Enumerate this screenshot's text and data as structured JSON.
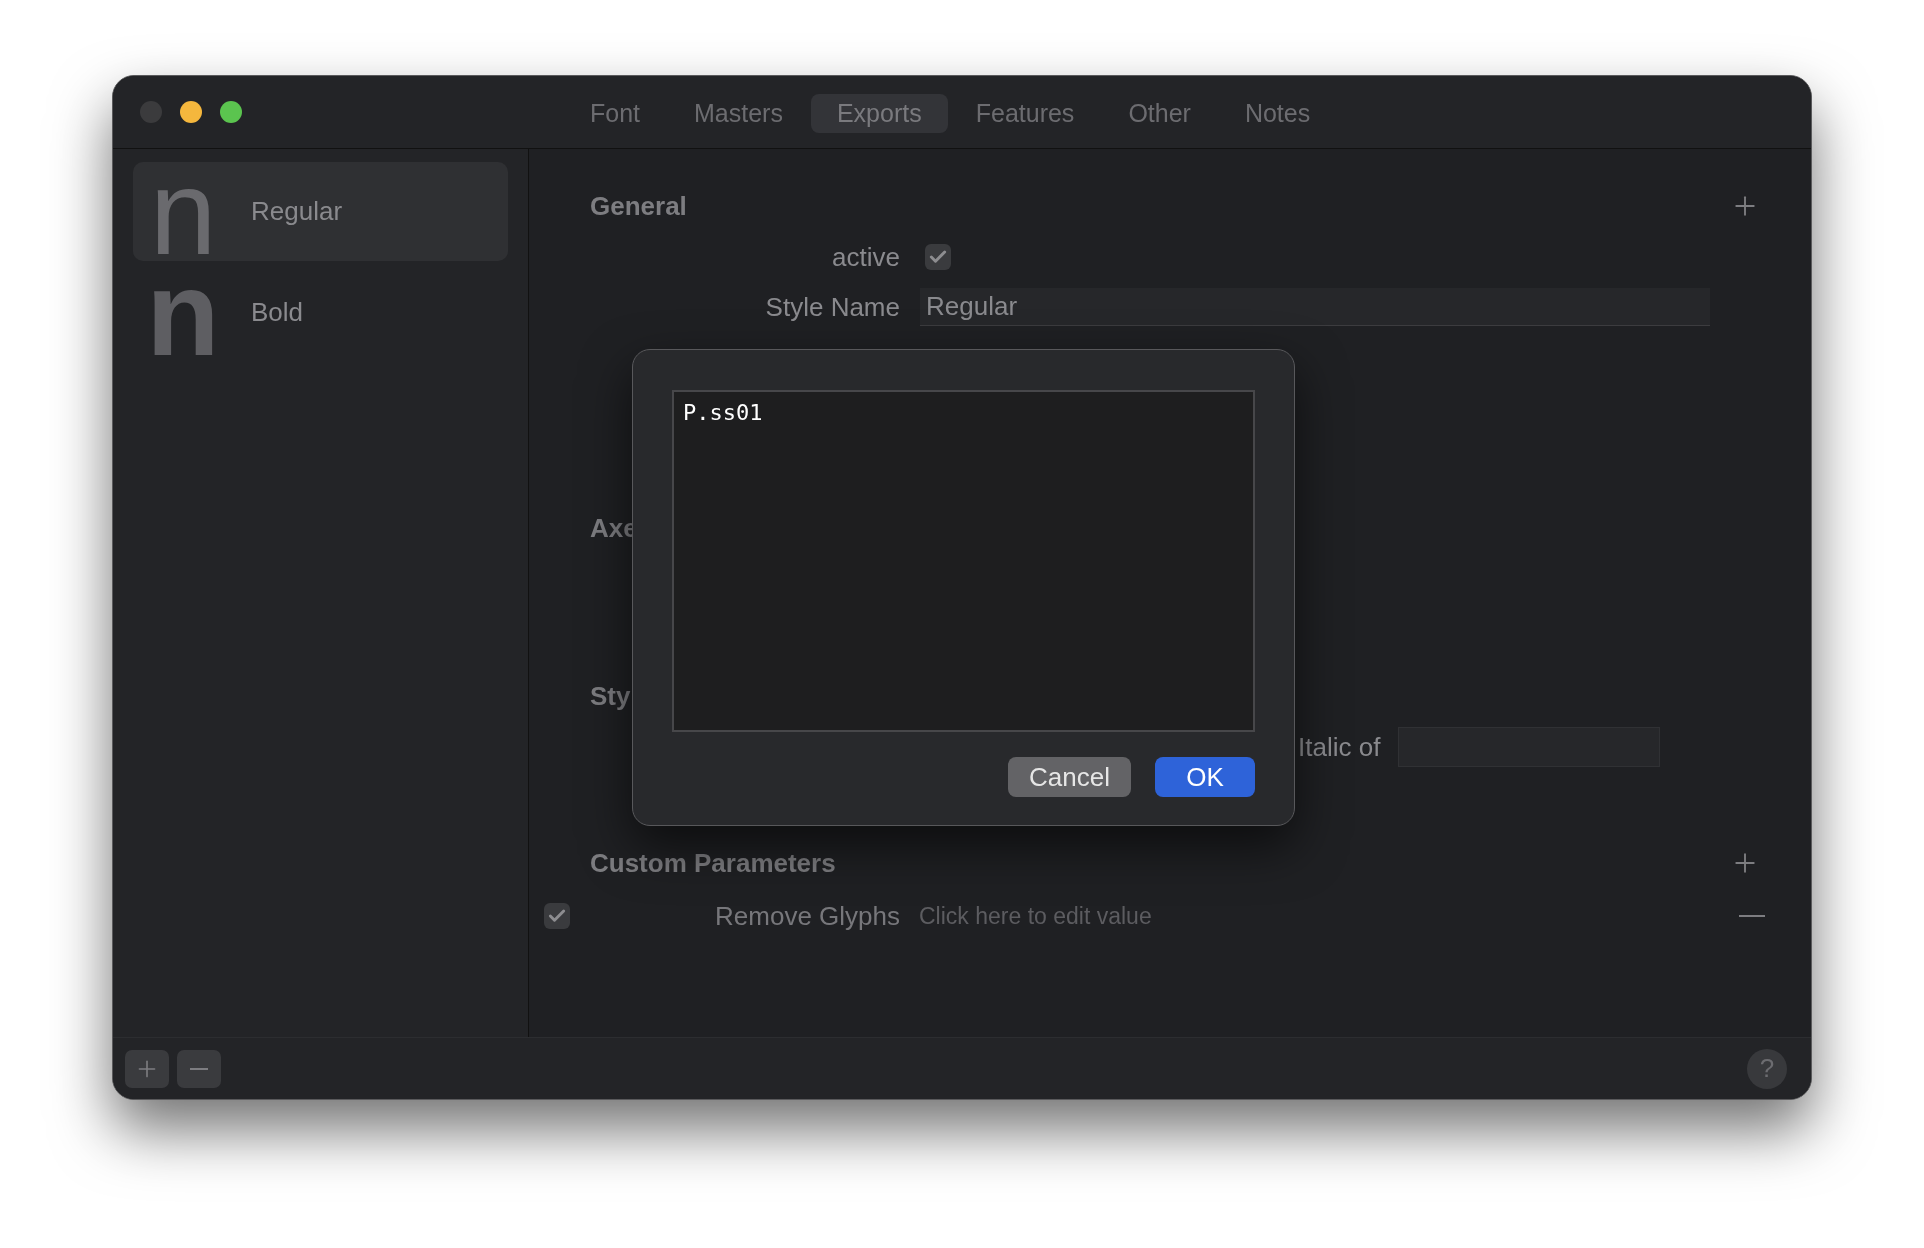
{
  "window": {
    "traffic_lights": [
      {
        "color": "#3b3b3d"
      },
      {
        "color": "#f5b73d"
      },
      {
        "color": "#5bc44f"
      }
    ]
  },
  "tabs": [
    {
      "label": "Font",
      "selected": false
    },
    {
      "label": "Masters",
      "selected": false
    },
    {
      "label": "Exports",
      "selected": true
    },
    {
      "label": "Features",
      "selected": false
    },
    {
      "label": "Other",
      "selected": false
    },
    {
      "label": "Notes",
      "selected": false
    }
  ],
  "sidebar": {
    "items": [
      {
        "glyph": "n",
        "kind": "thin",
        "name": "Regular",
        "selected": true
      },
      {
        "glyph": "n",
        "kind": "bold",
        "name": "Bold",
        "selected": false
      }
    ]
  },
  "general": {
    "title": "General",
    "active": {
      "label": "active",
      "checked": true
    },
    "style_name": {
      "label": "Style Name",
      "value": "Regular"
    }
  },
  "axes_heading": "Axe",
  "style_heading": "Sty",
  "italic_of": {
    "label": "Italic of"
  },
  "custom_parameters": {
    "title": "Custom Parameters",
    "rows": [
      {
        "checked": true,
        "name": "Remove Glyphs",
        "placeholder": "Click here to edit value"
      }
    ]
  },
  "dialog": {
    "text": "P.ss01",
    "buttons": [
      {
        "label": "Cancel",
        "kind": "secondary"
      },
      {
        "label": "OK",
        "kind": "primary"
      }
    ]
  },
  "bottom_bar": {
    "help": "?"
  }
}
